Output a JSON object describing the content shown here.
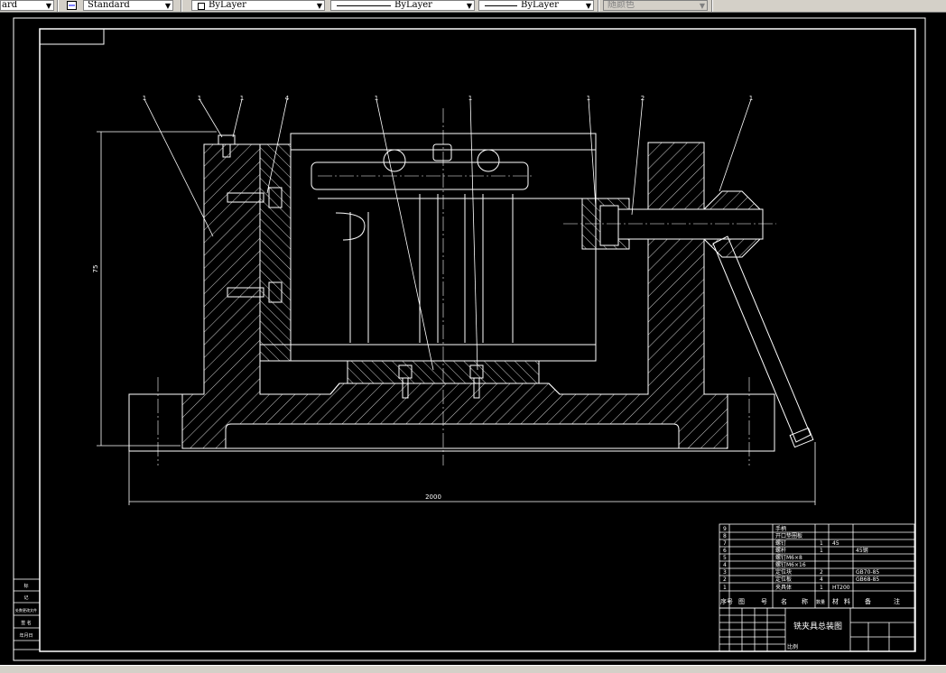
{
  "toolbar": {
    "text_style_partial": "ard",
    "dim_style": "Standard",
    "layer": "ByLayer",
    "linetype": "ByLayer",
    "lineweight": "ByLayer",
    "plot_style": "随颜色"
  },
  "drawing": {
    "balloon_numbers": [
      "1",
      "1",
      "1",
      "4",
      "1",
      "1",
      "1",
      "2",
      "1"
    ],
    "dim_height": "75",
    "dim_width": "2000",
    "title_block": {
      "title": "铣夹具总装图",
      "sheet": "比例",
      "parts": [
        {
          "no": "9",
          "name": "手柄"
        },
        {
          "no": "8",
          "name": "开口垫圈板"
        },
        {
          "no": "7",
          "name": "螺钉",
          "qty": "1",
          "mat": "45",
          "note": ""
        },
        {
          "no": "6",
          "name": "螺杆",
          "qty": "1",
          "mat": "",
          "note": "45钢"
        },
        {
          "no": "5",
          "name": "螺钉M6×8",
          "qty": "",
          "mat": "",
          "note": ""
        },
        {
          "no": "4",
          "name": "螺钉M6×16",
          "qty": "",
          "mat": "",
          "note": ""
        },
        {
          "no": "3",
          "name": "定位块",
          "qty": "2",
          "mat": "",
          "note": "GB70-85"
        },
        {
          "no": "2",
          "name": "定位板",
          "qty": "4",
          "mat": "",
          "note": "GB68-85"
        },
        {
          "no": "1",
          "name": "夹具体",
          "qty": "1",
          "mat": "HT200",
          "note": ""
        }
      ],
      "header": [
        "序号",
        "图",
        "号",
        "名",
        "称",
        "数量",
        "材",
        "料",
        "备",
        "注"
      ]
    },
    "side_table": [
      "标",
      "记",
      "处数更改文件",
      "签  名",
      "年月日"
    ]
  }
}
